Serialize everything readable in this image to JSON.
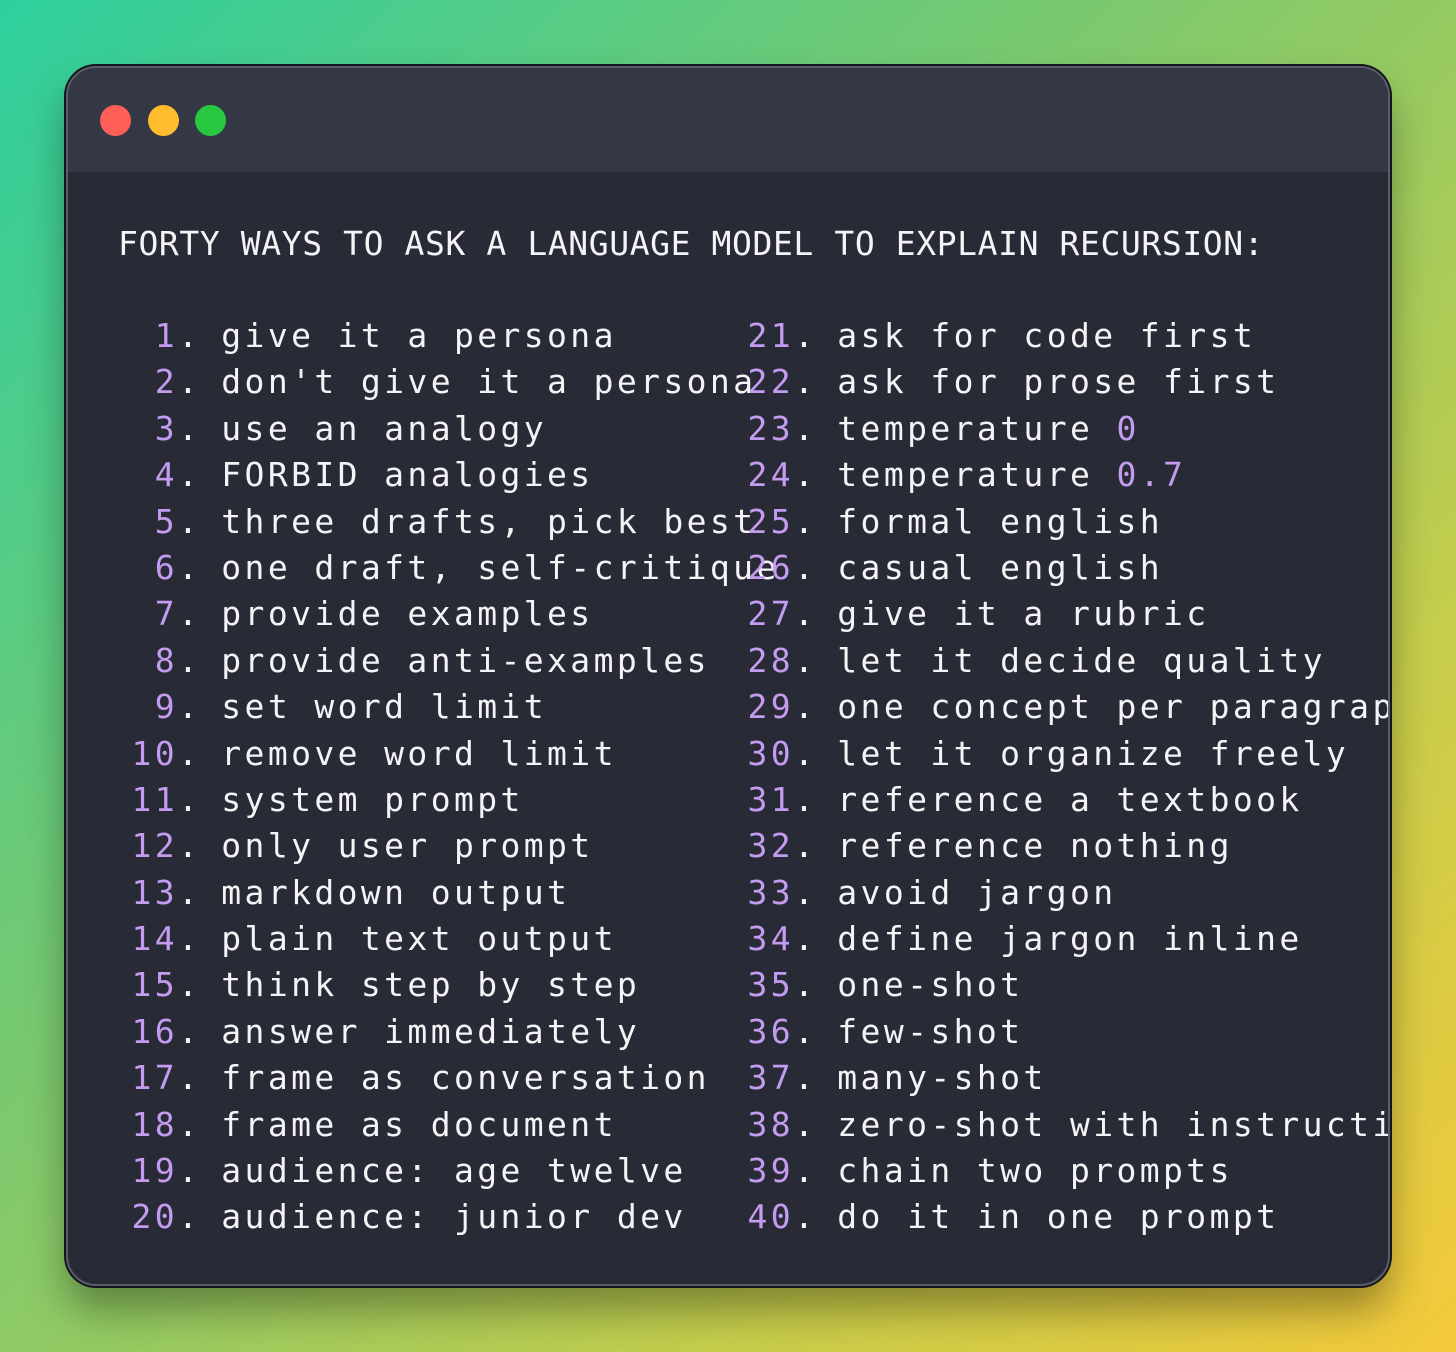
{
  "colors": {
    "number": "#c39cf0",
    "text": "#f4f4f6",
    "window_bg": "#282a36",
    "titlebar_bg": "#343744",
    "traffic_red": "#ff5f57",
    "traffic_yellow": "#febc2e",
    "traffic_green": "#28c840"
  },
  "window": {
    "controls": [
      "close-dot",
      "minimize-dot",
      "maximize-dot"
    ]
  },
  "title": "FORTY WAYS TO ASK A LANGUAGE MODEL TO EXPLAIN RECURSION:",
  "list_left": [
    {
      "num": "1",
      "text": "give it a persona"
    },
    {
      "num": "2",
      "text": "don't give it a persona"
    },
    {
      "num": "3",
      "text": "use an analogy"
    },
    {
      "num": "4",
      "text": "FORBID analogies"
    },
    {
      "num": "5",
      "text": "three drafts, pick best"
    },
    {
      "num": "6",
      "text": "one draft, self-critique"
    },
    {
      "num": "7",
      "text": "provide examples"
    },
    {
      "num": "8",
      "text": "provide anti-examples"
    },
    {
      "num": "9",
      "text": "set word limit"
    },
    {
      "num": "10",
      "text": "remove word limit"
    },
    {
      "num": "11",
      "text": "system prompt"
    },
    {
      "num": "12",
      "text": "only user prompt"
    },
    {
      "num": "13",
      "text": "markdown output"
    },
    {
      "num": "14",
      "text": "plain text output"
    },
    {
      "num": "15",
      "text": "think step by step"
    },
    {
      "num": "16",
      "text": "answer immediately"
    },
    {
      "num": "17",
      "text": "frame as conversation"
    },
    {
      "num": "18",
      "text": "frame as document"
    },
    {
      "num": "19",
      "text": "audience: age twelve"
    },
    {
      "num": "20",
      "text": "audience: junior dev"
    }
  ],
  "list_right": [
    {
      "num": "21",
      "text": "ask for code first"
    },
    {
      "num": "22",
      "text": "ask for prose first"
    },
    {
      "num": "23",
      "text": "temperature ",
      "value": "0"
    },
    {
      "num": "24",
      "text": "temperature ",
      "value": "0.7"
    },
    {
      "num": "25",
      "text": "formal english"
    },
    {
      "num": "26",
      "text": "casual english"
    },
    {
      "num": "27",
      "text": "give it a rubric"
    },
    {
      "num": "28",
      "text": "let it decide quality"
    },
    {
      "num": "29",
      "text": "one concept per paragraph"
    },
    {
      "num": "30",
      "text": "let it organize freely"
    },
    {
      "num": "31",
      "text": "reference a textbook"
    },
    {
      "num": "32",
      "text": "reference nothing"
    },
    {
      "num": "33",
      "text": "avoid jargon"
    },
    {
      "num": "34",
      "text": "define jargon inline"
    },
    {
      "num": "35",
      "text": "one-shot"
    },
    {
      "num": "36",
      "text": "few-shot"
    },
    {
      "num": "37",
      "text": "many-shot"
    },
    {
      "num": "38",
      "text": "zero-shot with instructions"
    },
    {
      "num": "39",
      "text": "chain two prompts"
    },
    {
      "num": "40",
      "text": "do it in one prompt"
    }
  ]
}
